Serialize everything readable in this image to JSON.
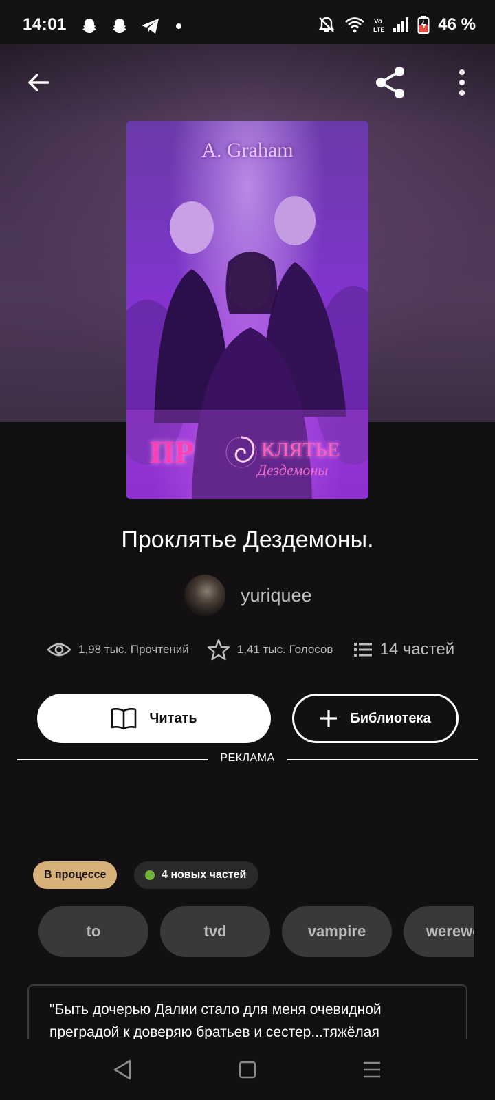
{
  "status_bar": {
    "time": "14:01",
    "battery_text": "46 %",
    "left_icons": [
      "snapchat-icon",
      "snapchat-icon",
      "telegram-icon",
      "dot-icon"
    ],
    "right_icons": [
      "bell-off-icon",
      "wifi-icon",
      "volte-icon",
      "signal-icon",
      "battery-icon"
    ]
  },
  "cover": {
    "author": "A. Graham",
    "title_part1": "ПР",
    "title_part2": "КЛЯТЬЕ",
    "title_script": "Дездемоны"
  },
  "book": {
    "title": "Проклятье Дездемоны.",
    "author": "yuriquee"
  },
  "stats": {
    "reads": "1,98 тыс. Прочтений",
    "votes": "1,41 тыс. Голосов",
    "parts": "14 частей"
  },
  "buttons": {
    "read": "Читать",
    "library": "Библиотека"
  },
  "ad_label": "РЕКЛАМА",
  "badges": {
    "status": "В процессе",
    "new_parts": "4 новых частей"
  },
  "tags": [
    "to",
    "tvd",
    "vampire",
    "werewolf"
  ],
  "description": "\"Быть дочерью Далии стало для меня очевидной преградой к доверяю братьев и сестер...тяжёлая",
  "colors": {
    "background": "#121013",
    "status_badge": "#d8b07a",
    "new_dot": "#6fb33a",
    "tag_bg": "#3a3939"
  }
}
